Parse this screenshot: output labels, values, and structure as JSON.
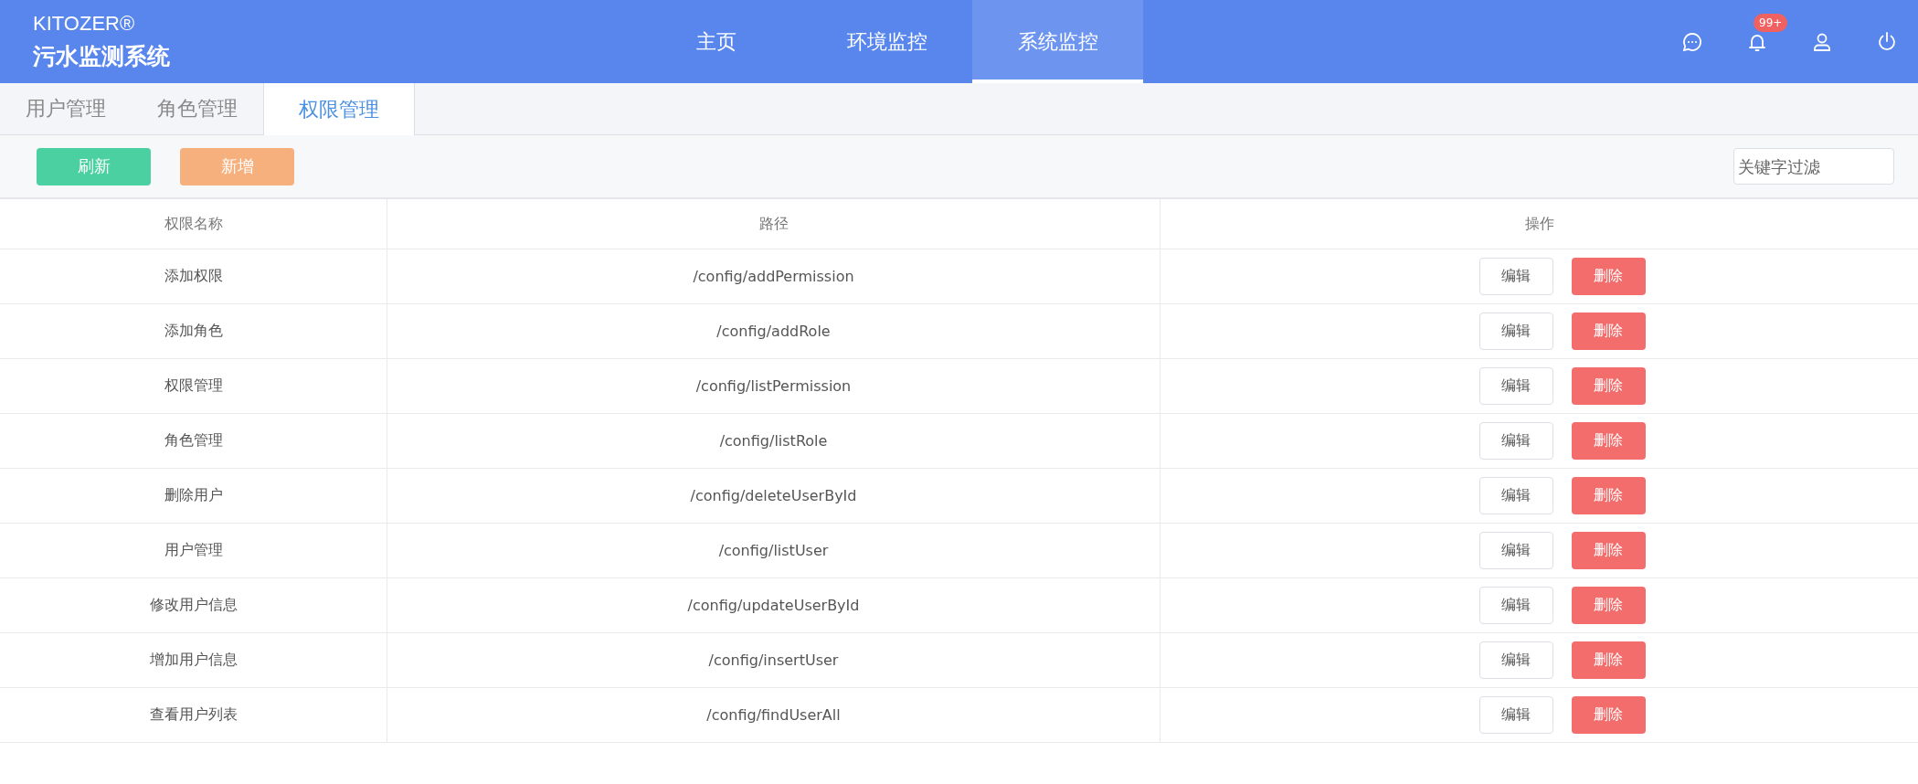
{
  "brand": {
    "name": "KITOZER®",
    "title": "污水监测系统"
  },
  "nav": [
    {
      "label": "主页",
      "selected": false
    },
    {
      "label": "环境监控",
      "selected": false
    },
    {
      "label": "系统监控",
      "selected": true
    }
  ],
  "notifications": {
    "badge": "99+"
  },
  "tabs": [
    {
      "label": "用户管理",
      "selected": false
    },
    {
      "label": "角色管理",
      "selected": false
    },
    {
      "label": "权限管理",
      "selected": true
    }
  ],
  "toolbar": {
    "refresh": "刷新",
    "add": "新增",
    "filter": {
      "placeholder": "关键字过滤"
    }
  },
  "table": {
    "columns": [
      "权限名称",
      "路径",
      "操作"
    ],
    "rows": [
      {
        "name": "添加权限",
        "path": "/config/addPermission",
        "edit": "编辑",
        "delete": "删除"
      },
      {
        "name": "添加角色",
        "path": "/config/addRole",
        "edit": "编辑",
        "delete": "删除"
      },
      {
        "name": "权限管理",
        "path": "/config/listPermission",
        "edit": "编辑",
        "delete": "删除"
      },
      {
        "name": "角色管理",
        "path": "/config/listRole",
        "edit": "编辑",
        "delete": "删除"
      },
      {
        "name": "删除用户",
        "path": "/config/deleteUserById",
        "edit": "编辑",
        "delete": "删除"
      },
      {
        "name": "用户管理",
        "path": "/config/listUser",
        "edit": "编辑",
        "delete": "删除"
      },
      {
        "name": "修改用户信息",
        "path": "/config/updateUserById",
        "edit": "编辑",
        "delete": "删除"
      },
      {
        "name": "增加用户信息",
        "path": "/config/insertUser",
        "edit": "编辑",
        "delete": "删除"
      },
      {
        "name": "查看用户列表",
        "path": "/config/findUserAll",
        "edit": "编辑",
        "delete": "删除"
      }
    ]
  }
}
